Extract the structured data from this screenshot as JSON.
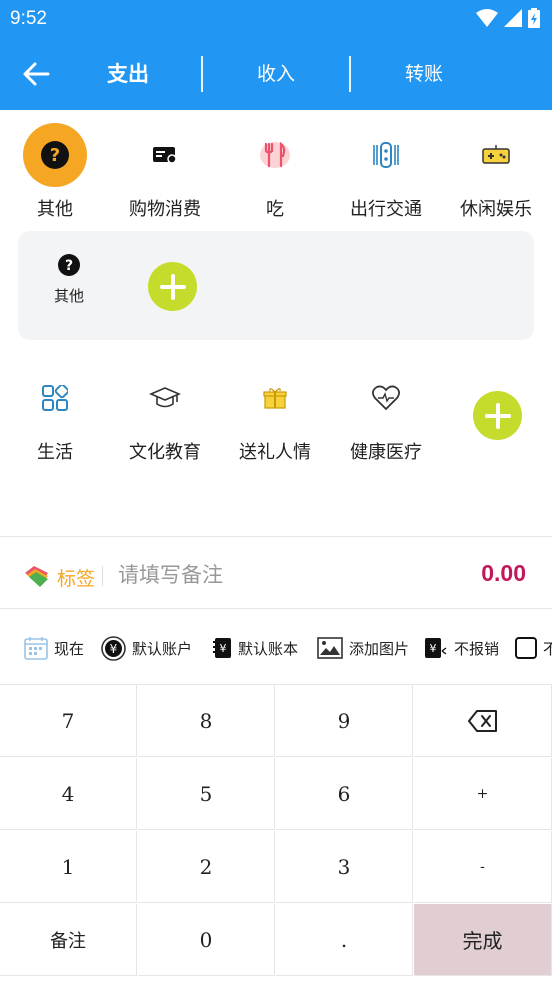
{
  "status": {
    "time": "9:52"
  },
  "tabs": [
    {
      "label": "支出",
      "active": true
    },
    {
      "label": "收入",
      "active": false
    },
    {
      "label": "转账",
      "active": false
    }
  ],
  "categories_row1": [
    {
      "label": "其他",
      "icon": "question-icon",
      "selected": true
    },
    {
      "label": "购物消费",
      "icon": "card-icon"
    },
    {
      "label": "吃",
      "icon": "fork-knife-icon"
    },
    {
      "label": "出行交通",
      "icon": "transit-icon"
    },
    {
      "label": "休闲娱乐",
      "icon": "gamepad-icon"
    }
  ],
  "sub_categories": [
    {
      "label": "其他",
      "icon": "question-icon"
    }
  ],
  "categories_row2": [
    {
      "label": "生活",
      "icon": "grid-icon"
    },
    {
      "label": "文化教育",
      "icon": "graduation-cap-icon"
    },
    {
      "label": "送礼人情",
      "icon": "gift-icon"
    },
    {
      "label": "健康医疗",
      "icon": "heart-pulse-icon"
    }
  ],
  "input": {
    "tag_label": "标签",
    "remark_placeholder": "请填写备注",
    "amount": "0.00"
  },
  "options": [
    {
      "label": "现在",
      "icon": "calendar-icon"
    },
    {
      "label": "默认账户",
      "icon": "yuan-coin-icon"
    },
    {
      "label": "默认账本",
      "icon": "ledger-icon"
    },
    {
      "label": "添加图片",
      "icon": "image-icon"
    },
    {
      "label": "不报销",
      "icon": "reimburse-icon"
    },
    {
      "label": "不",
      "icon": "checkbox-icon"
    }
  ],
  "keypad": [
    [
      "7",
      "8",
      "9",
      "⌫"
    ],
    [
      "4",
      "5",
      "6",
      "+"
    ],
    [
      "1",
      "2",
      "3",
      "-"
    ],
    [
      "备注",
      "0",
      ".",
      "完成"
    ]
  ],
  "colors": {
    "primary": "#2196F3",
    "accent": "#F5A623",
    "add": "#C5DC2C",
    "amount": "#C2185B",
    "done": "#E1CED3"
  }
}
